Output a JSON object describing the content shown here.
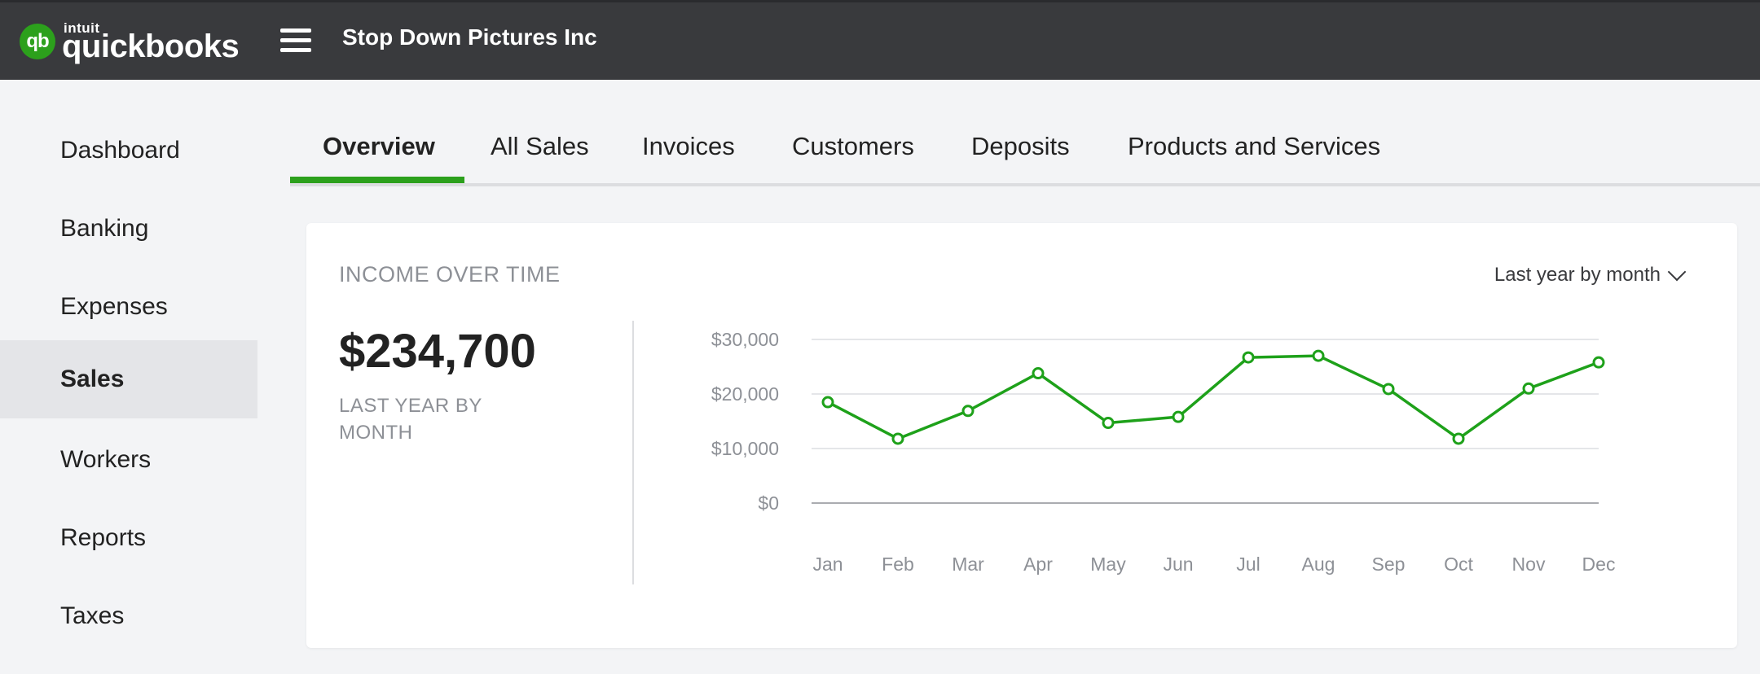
{
  "header": {
    "logo_intuit": "intuit",
    "logo_name": "quickbooks",
    "logo_badge": "qb",
    "company_name": "Stop Down Pictures Inc"
  },
  "sidebar": {
    "items": [
      {
        "label": "Dashboard",
        "active": false
      },
      {
        "label": "Banking",
        "active": false
      },
      {
        "label": "Expenses",
        "active": false
      },
      {
        "label": "Sales",
        "active": true
      },
      {
        "label": "Workers",
        "active": false
      },
      {
        "label": "Reports",
        "active": false
      },
      {
        "label": "Taxes",
        "active": false
      }
    ]
  },
  "tabs": [
    {
      "label": "Overview",
      "active": true
    },
    {
      "label": "All Sales",
      "active": false
    },
    {
      "label": "Invoices",
      "active": false
    },
    {
      "label": "Customers",
      "active": false
    },
    {
      "label": "Deposits",
      "active": false
    },
    {
      "label": "Products and Services",
      "active": false
    }
  ],
  "income_card": {
    "title": "INCOME OVER TIME",
    "period_selector": "Last year by month",
    "total": "$234,700",
    "total_label": "LAST YEAR BY MONTH"
  },
  "colors": {
    "accent": "#2ca01c",
    "topbar": "#393a3d",
    "line": "#1ea11a"
  },
  "chart_data": {
    "type": "line",
    "categories": [
      "Jan",
      "Feb",
      "Mar",
      "Apr",
      "May",
      "Jun",
      "Jul",
      "Aug",
      "Sep",
      "Oct",
      "Nov",
      "Dec"
    ],
    "values": [
      18500,
      11800,
      16900,
      23800,
      14700,
      15800,
      26700,
      27000,
      20900,
      11800,
      21000,
      25800
    ],
    "y_ticks": [
      "$30,000",
      "$20,000",
      "$10,000",
      "$0"
    ],
    "y_tick_values": [
      30000,
      20000,
      10000,
      0
    ],
    "ylim": [
      0,
      30000
    ],
    "grid": true
  }
}
